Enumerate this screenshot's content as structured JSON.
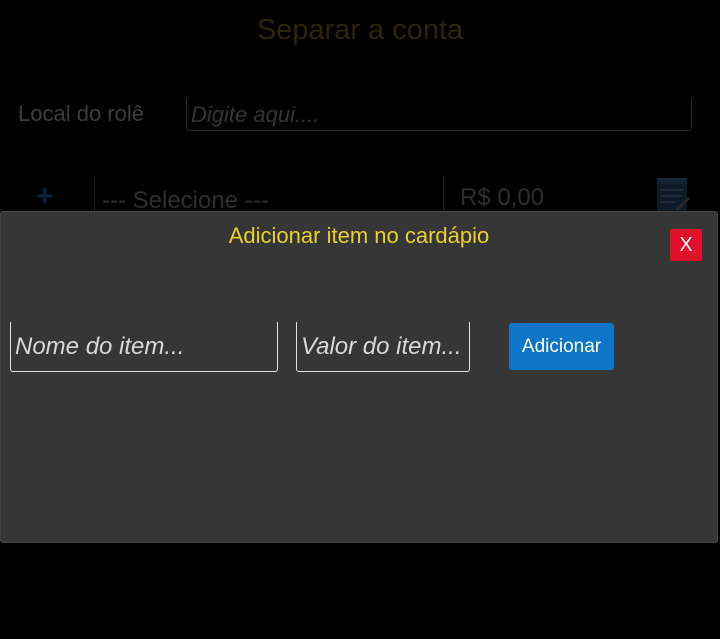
{
  "page": {
    "title": "Separar a conta",
    "local_label": "Local do rolê",
    "local_placeholder": "Digite aqui....",
    "add_row_icon": "plus-icon",
    "select_value": "--- Selecione ---",
    "price_value": "R$ 0,00",
    "edit_icon": "document-edit-icon"
  },
  "modal": {
    "title": "Adicionar item no cardápio",
    "close_label": "X",
    "name_placeholder": "Nome do item...",
    "value_placeholder": "Valor do item...",
    "add_label": "Adicionar"
  },
  "colors": {
    "background": "#000000",
    "modal_background": "#363636",
    "modal_title": "#e9d12a",
    "close_button": "#e0102a",
    "add_button": "#0d77c7"
  }
}
